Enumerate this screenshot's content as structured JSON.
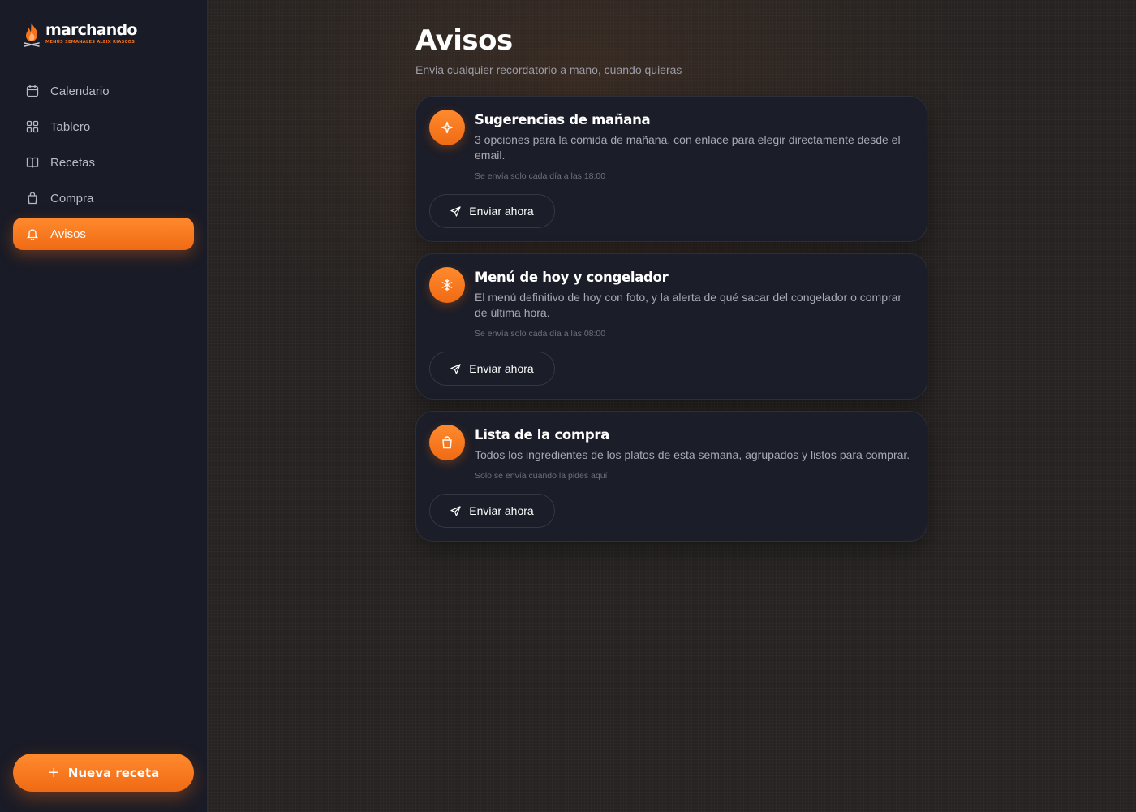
{
  "brand": {
    "name": "marchando",
    "tagline": "MENÚS SEMANALES ALEIX RIASCOS",
    "accent_color": "#f5731c"
  },
  "sidebar": {
    "items": [
      {
        "label": "Calendario",
        "icon": "calendar-icon",
        "active": false
      },
      {
        "label": "Tablero",
        "icon": "grid-icon",
        "active": false
      },
      {
        "label": "Recetas",
        "icon": "book-icon",
        "active": false
      },
      {
        "label": "Compra",
        "icon": "shopping-bag-icon",
        "active": false
      },
      {
        "label": "Avisos",
        "icon": "bell-icon",
        "active": true
      }
    ],
    "new_recipe_label": "Nueva receta"
  },
  "page": {
    "title": "Avisos",
    "subtitle": "Envia cualquier recordatorio a mano, cuando quieras"
  },
  "cards": [
    {
      "icon": "sparkle-icon",
      "title": "Sugerencias de mañana",
      "description": "3 opciones para la comida de mañana, con enlace para elegir directamente desde el email.",
      "note": "Se envía solo cada día a las 18:00",
      "button": "Enviar ahora"
    },
    {
      "icon": "snowflake-icon",
      "title": "Menú de hoy y congelador",
      "description": "El menú definitivo de hoy con foto, y la alerta de qué sacar del congelador o comprar de última hora.",
      "note": "Se envía solo cada día a las 08:00",
      "button": "Enviar ahora"
    },
    {
      "icon": "shopping-bag-icon",
      "title": "Lista de la compra",
      "description": "Todos los ingredientes de los platos de esta semana, agrupados y listos para comprar.",
      "note": "Solo se envía cuando la pides aquí",
      "button": "Enviar ahora"
    }
  ]
}
